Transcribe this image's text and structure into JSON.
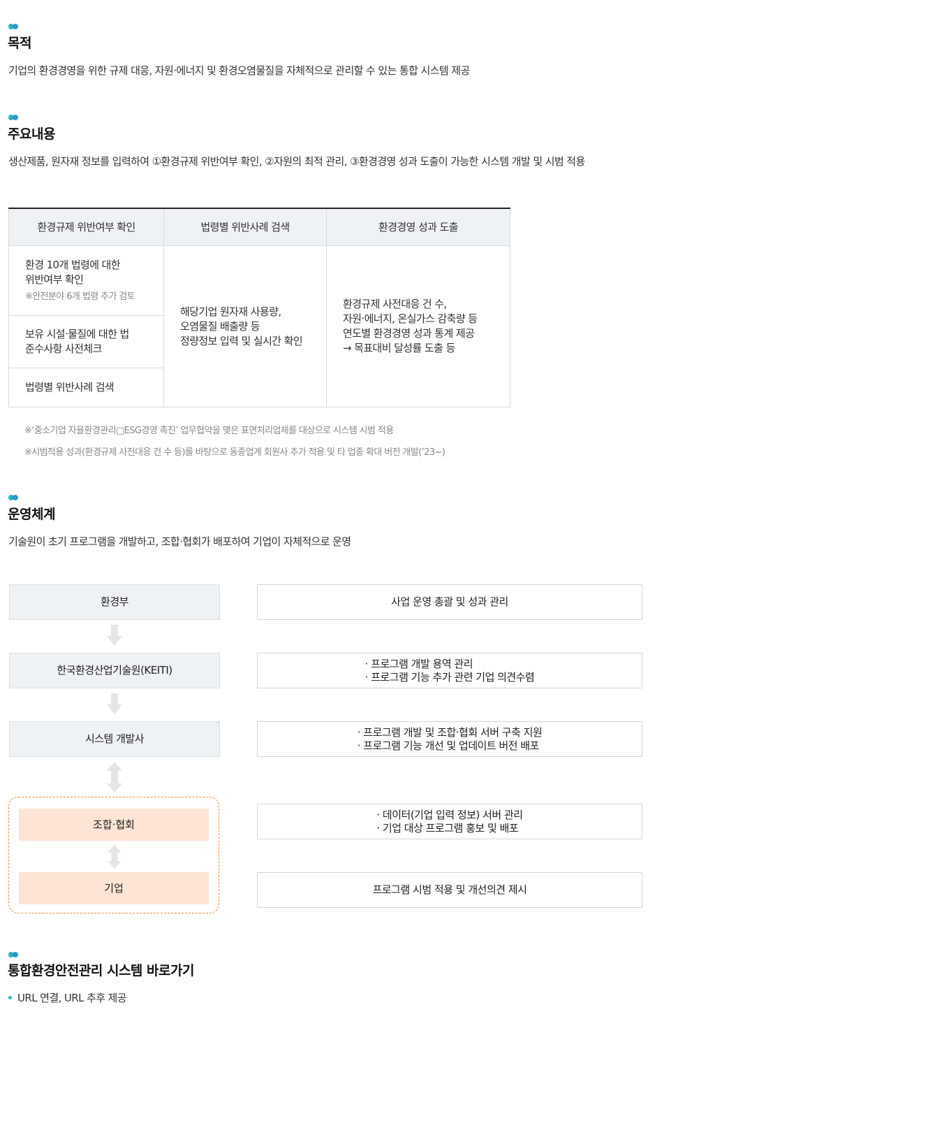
{
  "sections": {
    "purpose": {
      "title": "목적",
      "text": "기업의 환경경영을 위한 규제 대응, 자원·에너지 및 환경오염물질을 자체적으로 관리할 수 있는 통합 시스템 제공"
    },
    "main_content": {
      "title": "주요내용",
      "text": "생산제품, 원자재 정보를 입력하여 ①환경규제 위반여부 확인, ②자원의 최적 관리, ③환경경영 성과 도출이 가능한 시스템 개발 및 시범 적용",
      "table": {
        "headers": [
          "환경규제 위반여부 확인",
          "법령별 위반사례 검색",
          "환경경영 성과 도출"
        ],
        "col1": {
          "row1_line1": "환경 10개 법령에 대한",
          "row1_line2": "위반여부 확인",
          "row1_note": "※안전분야 6개 법령 추가 검토",
          "row2_line1": "보유 시설·물질에 대한 법",
          "row2_line2": "준수사항 사전체크",
          "row3": "법령별 위반사례 검색"
        },
        "col2": [
          "해당기업 원자재 사용량,",
          "오염물질 배출량 등",
          "정량정보 입력 및 실시간 확인"
        ],
        "col3": [
          "환경규제 사전대응 건 수,",
          "자원·에너지, 온실가스 감축량 등",
          "연도별 환경경영 성과 통계 제공",
          "→ 목표대비 달성률 도출 등"
        ]
      },
      "notes": [
        "※‘중소기업 자율환경관리□ESG경영 촉진’ 업무협약을 맺은 표면처리업체를 대상으로 시스템 시범 적용",
        "※시범적용 성과(환경규제 사전대응 건 수 등)를 바탕으로 동종업계 회원사 추가 적용 및 타 업종 확대 버전 개발(’23~)"
      ]
    },
    "operation": {
      "title": "운영체계",
      "text": "기술원이 초기 프로그램을 개발하고, 조합·협회가 배포하여 기업이 자체적으로 운영",
      "org": {
        "ministry": "환경부",
        "keiti": "한국환경산업기술원(KEITI)",
        "developer": "시스템 개발사",
        "association": "조합·협회",
        "company": "기업"
      },
      "roles": {
        "ministry": [
          "사업 운영 총괄 및 성과 관리"
        ],
        "keiti": [
          "· 프로그램 개발 용역 관리",
          "· 프로그램 기능 추가 관련 기업 의견수렴"
        ],
        "developer": [
          "· 프로그램 개발 및 조합·협회 서버 구축 지원",
          "· 프로그램 기능 개선 및 업데이트 버전 배포"
        ],
        "association": [
          "· 데이터(기업 입력 정보) 서버 관리",
          "· 기업 대상 프로그램 홍보 및 배포"
        ],
        "company": [
          "프로그램 시범 적용 및 개선의견 제시"
        ]
      }
    },
    "shortcut": {
      "title": "통합환경안전관리 시스템 바로가기",
      "item": "URL 연결, URL 추후 제공"
    }
  },
  "colors": {
    "accent_teal": "#2fb3c0",
    "accent_blue": "#1f8ec7",
    "header_bg": "#eef2f5",
    "peach": "#fde4d4",
    "dashed_orange": "#f08a3c"
  }
}
